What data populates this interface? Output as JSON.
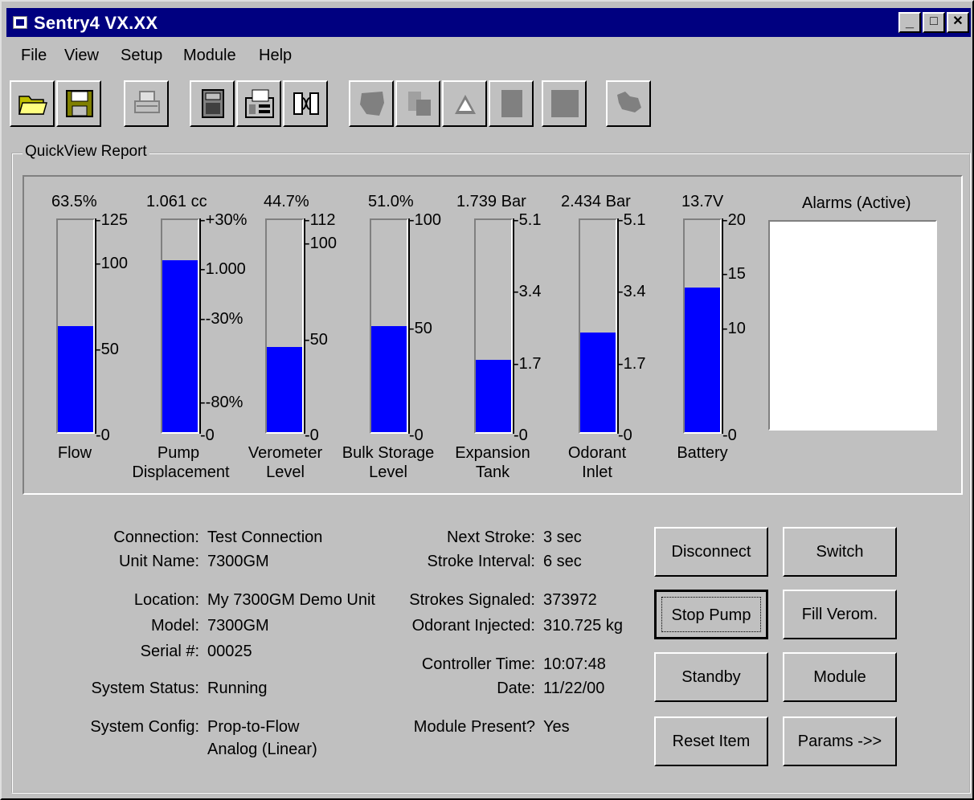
{
  "window": {
    "title": "Sentry4 VX.XX",
    "min_label": "_",
    "max_label": "□",
    "close_label": "✕"
  },
  "menu": {
    "items": [
      "File",
      "View",
      "Setup",
      "Module",
      "Help"
    ]
  },
  "toolbar": {
    "icons": [
      "open-folder-icon",
      "save-icon",
      "print-icon",
      "module-icon",
      "fax-icon",
      "connect-icon",
      "map-icon",
      "database-icon",
      "alarm-icon",
      "panel-icon",
      "panel2-icon",
      "dog-icon"
    ]
  },
  "quickview": {
    "group_label": "QuickView Report",
    "gauges": [
      {
        "id": "flow",
        "value_text": "63.5%",
        "label_line1": "Flow",
        "label_line2": "",
        "fill_fraction": 0.5,
        "ticks": [
          "-125",
          "-100",
          "-50",
          "-0"
        ]
      },
      {
        "id": "pump",
        "value_text": "1.061 cc",
        "label_line1": "Pump",
        "label_line2": "Displacement",
        "fill_fraction": 0.81,
        "ticks": [
          "-+30%",
          "-1.000",
          "--30%",
          "--80%",
          "-0"
        ]
      },
      {
        "id": "verometer",
        "value_text": "44.7%",
        "label_line1": "Verometer",
        "label_line2": "Level",
        "fill_fraction": 0.4,
        "ticks": [
          "-112",
          "-100",
          "-50",
          "-0"
        ]
      },
      {
        "id": "bulk",
        "value_text": "51.0%",
        "label_line1": "Bulk Storage",
        "label_line2": "Level",
        "fill_fraction": 0.5,
        "ticks": [
          "-100",
          "-50",
          "-0"
        ]
      },
      {
        "id": "expansion",
        "value_text": "1.739 Bar",
        "label_line1": "Expansion",
        "label_line2": "Tank",
        "fill_fraction": 0.34,
        "ticks": [
          "-5.1",
          "-3.4",
          "-1.7",
          "-0"
        ]
      },
      {
        "id": "odorant",
        "value_text": "2.434 Bar",
        "label_line1": "Odorant",
        "label_line2": "Inlet",
        "fill_fraction": 0.47,
        "ticks": [
          "-5.1",
          "-3.4",
          "-1.7",
          "-0"
        ]
      },
      {
        "id": "battery",
        "value_text": "13.7V",
        "label_line1": "Battery",
        "label_line2": "",
        "fill_fraction": 0.68,
        "ticks": [
          "-20",
          "-15",
          "-10",
          "-0"
        ]
      }
    ],
    "alarms_title": "Alarms (Active)"
  },
  "status": {
    "connection_label": "Connection:",
    "connection_value": "Test Connection",
    "unit_name_label": "Unit Name:",
    "unit_name_value": "7300GM",
    "location_label": "Location:",
    "location_value": "My 7300GM Demo Unit",
    "model_label": "Model:",
    "model_value": "7300GM",
    "serial_label": "Serial #:",
    "serial_value": "00025",
    "system_status_label": "System Status:",
    "system_status_value": "Running",
    "system_config_label": "System Config:",
    "system_config_value1": "Prop-to-Flow",
    "system_config_value2": "Analog (Linear)",
    "next_stroke_label": "Next Stroke:",
    "next_stroke_value": "3 sec",
    "stroke_interval_label": "Stroke Interval:",
    "stroke_interval_value": "6 sec",
    "strokes_signaled_label": "Strokes Signaled:",
    "strokes_signaled_value": "373972",
    "odorant_injected_label": "Odorant Injected:",
    "odorant_injected_value": "310.725 kg",
    "controller_time_label": "Controller Time:",
    "controller_time_value": "10:07:48",
    "date_label": "Date:",
    "date_value": "11/22/00",
    "module_present_label": "Module Present?",
    "module_present_value": "Yes"
  },
  "buttons": {
    "disconnect": "Disconnect",
    "switch": "Switch",
    "stop_pump": "Stop Pump",
    "fill_verom": "Fill Verom.",
    "standby": "Standby",
    "module": "Module",
    "reset_item": "Reset Item",
    "params": "Params ->>"
  }
}
